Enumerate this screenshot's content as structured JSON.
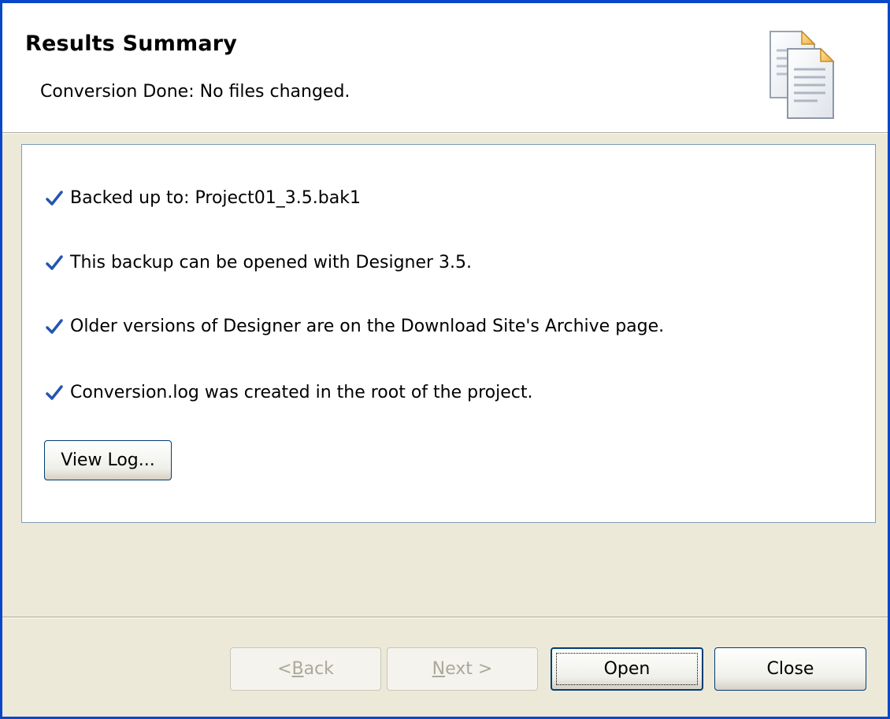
{
  "header": {
    "title": "Results Summary",
    "subtitle": "Conversion Done: No files changed.",
    "icon": "documents-icon"
  },
  "summary": {
    "items": [
      {
        "icon": "checkmark-icon",
        "text": "Backed up to:  Project01_3.5.bak1"
      },
      {
        "icon": "checkmark-icon",
        "text": "This backup can be opened with Designer 3.5."
      },
      {
        "icon": "checkmark-icon",
        "text": "Older versions of Designer are on the Download Site's Archive page."
      },
      {
        "icon": "checkmark-icon",
        "text": "Conversion.log was created in the root of the project."
      }
    ],
    "view_log_label": "View Log..."
  },
  "footer": {
    "back": {
      "prefix": "< ",
      "mnemonic": "B",
      "rest": "ack",
      "enabled": false
    },
    "next": {
      "mnemonic": "N",
      "rest": "ext >",
      "enabled": false
    },
    "open_label": "Open",
    "close_label": "Close"
  },
  "colors": {
    "window_border": "#0a47c8",
    "dialog_background": "#ece9d8",
    "check": "#2455b0"
  }
}
